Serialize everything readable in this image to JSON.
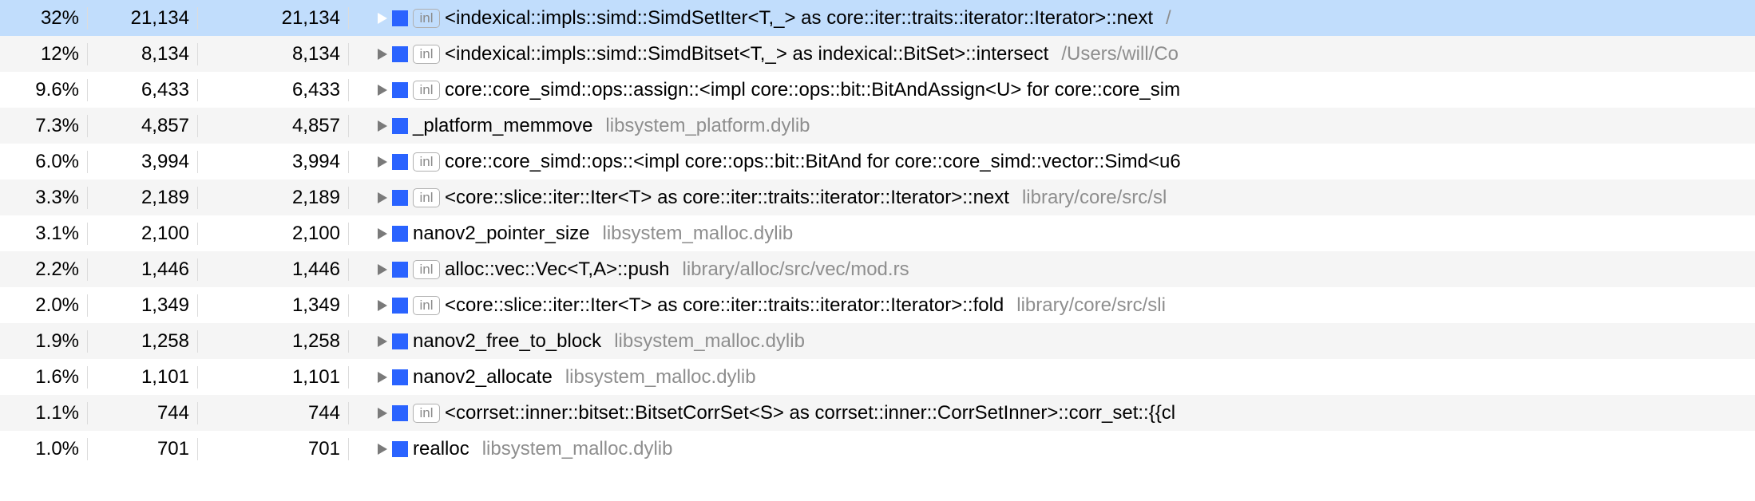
{
  "rows": [
    {
      "pct": "32%",
      "count": "21,134",
      "self": "21,134",
      "inl": true,
      "symbol": "<indexical::impls::simd::SimdSetIter<T,_> as core::iter::traits::iterator::Iterator>::next",
      "lib": "/",
      "selected": true,
      "alt": false
    },
    {
      "pct": "12%",
      "count": "8,134",
      "self": "8,134",
      "inl": true,
      "symbol": "<indexical::impls::simd::SimdBitset<T,_> as indexical::BitSet>::intersect",
      "lib": "/Users/will/Co",
      "selected": false,
      "alt": true
    },
    {
      "pct": "9.6%",
      "count": "6,433",
      "self": "6,433",
      "inl": true,
      "symbol": "core::core_simd::ops::assign::<impl core::ops::bit::BitAndAssign<U> for core::core_sim",
      "lib": "",
      "selected": false,
      "alt": false
    },
    {
      "pct": "7.3%",
      "count": "4,857",
      "self": "4,857",
      "inl": false,
      "symbol": "_platform_memmove",
      "lib": "libsystem_platform.dylib",
      "selected": false,
      "alt": true
    },
    {
      "pct": "6.0%",
      "count": "3,994",
      "self": "3,994",
      "inl": true,
      "symbol": "core::core_simd::ops::<impl core::ops::bit::BitAnd for core::core_simd::vector::Simd<u6",
      "lib": "",
      "selected": false,
      "alt": false
    },
    {
      "pct": "3.3%",
      "count": "2,189",
      "self": "2,189",
      "inl": true,
      "symbol": "<core::slice::iter::Iter<T> as core::iter::traits::iterator::Iterator>::next",
      "lib": "library/core/src/sl",
      "selected": false,
      "alt": true
    },
    {
      "pct": "3.1%",
      "count": "2,100",
      "self": "2,100",
      "inl": false,
      "symbol": "nanov2_pointer_size",
      "lib": "libsystem_malloc.dylib",
      "selected": false,
      "alt": false
    },
    {
      "pct": "2.2%",
      "count": "1,446",
      "self": "1,446",
      "inl": true,
      "symbol": "alloc::vec::Vec<T,A>::push",
      "lib": "library/alloc/src/vec/mod.rs",
      "selected": false,
      "alt": true
    },
    {
      "pct": "2.0%",
      "count": "1,349",
      "self": "1,349",
      "inl": true,
      "symbol": "<core::slice::iter::Iter<T> as core::iter::traits::iterator::Iterator>::fold",
      "lib": "library/core/src/sli",
      "selected": false,
      "alt": false
    },
    {
      "pct": "1.9%",
      "count": "1,258",
      "self": "1,258",
      "inl": false,
      "symbol": "nanov2_free_to_block",
      "lib": "libsystem_malloc.dylib",
      "selected": false,
      "alt": true
    },
    {
      "pct": "1.6%",
      "count": "1,101",
      "self": "1,101",
      "inl": false,
      "symbol": "nanov2_allocate",
      "lib": "libsystem_malloc.dylib",
      "selected": false,
      "alt": false
    },
    {
      "pct": "1.1%",
      "count": "744",
      "self": "744",
      "inl": true,
      "symbol": "<corrset::inner::bitset::BitsetCorrSet<S> as corrset::inner::CorrSetInner>::corr_set::{{cl",
      "lib": "",
      "selected": false,
      "alt": true
    },
    {
      "pct": "1.0%",
      "count": "701",
      "self": "701",
      "inl": false,
      "symbol": "realloc",
      "lib": "libsystem_malloc.dylib",
      "selected": false,
      "alt": false
    }
  ],
  "badge_label": "inl"
}
